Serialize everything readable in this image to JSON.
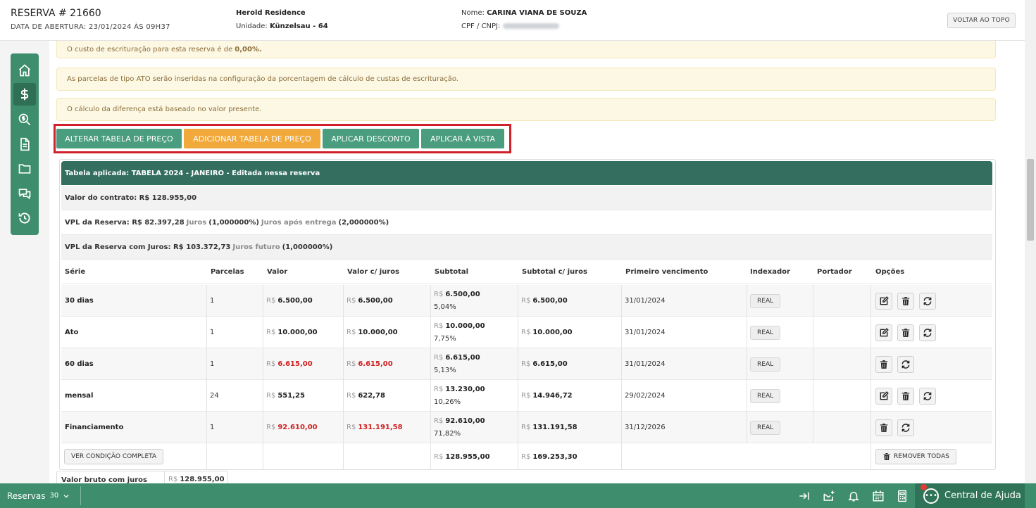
{
  "header": {
    "title": "RESERVA # 21660",
    "opening_label": "DATA DE ABERTURA:",
    "opening_value": "23/01/2024 ÀS 09H37",
    "empreendimento": "Herold Residence",
    "unidade_label": "Unidade:",
    "unidade_value": "Künzelsau - 64",
    "nome_label": "Nome:",
    "nome_value": "CARINA VIANA DE SOUZA",
    "cpf_label": "CPF / CNPJ:",
    "back_to_top": "VOLTAR AO TOPO"
  },
  "sidebar": {
    "items": [
      {
        "icon": "home-icon"
      },
      {
        "icon": "dollar-icon",
        "active": true
      },
      {
        "icon": "search-dollar-icon"
      },
      {
        "icon": "document-icon"
      },
      {
        "icon": "folder-icon"
      },
      {
        "icon": "comments-icon"
      },
      {
        "icon": "history-icon"
      }
    ]
  },
  "alerts": [
    {
      "text": "O custo de escrituração para esta reserva é de ",
      "strong": "0,00%."
    },
    {
      "text": "As parcelas de tipo ATO serão inseridas na configuração da porcentagem de cálculo de custas de escrituração."
    },
    {
      "text": "O cálculo da diferença está baseado no valor presente."
    }
  ],
  "actions": {
    "alterar": "ALTERAR TABELA DE PREÇO",
    "adicionar": "ADICIONAR TABELA DE PREÇO",
    "desconto": "APLICAR DESCONTO",
    "avista": "APLICAR À VISTA"
  },
  "table": {
    "applied": "Tabela aplicada: TABELA 2024 - JANEIRO - Editada nessa reserva",
    "contrato": "Valor do contrato: R$ 128.955,00",
    "vpl_label": "VPL da Reserva: R$ 82.397,28",
    "vpl_juros_lbl": "Juros",
    "vpl_juros_val": "(1,000000%)",
    "vpl_apos_lbl": "Juros após entrega",
    "vpl_apos_val": "(2,000000%)",
    "vplj_label": "VPL da Reserva com Juros: R$ 103.372,73",
    "vplj_fut_lbl": "Juros futuro",
    "vplj_fut_val": "(1,000000%)",
    "columns": [
      "Série",
      "Parcelas",
      "Valor",
      "Valor c/ juros",
      "Subtotal",
      "Subtotal c/ juros",
      "Primeiro vencimento",
      "Indexador",
      "Portador",
      "Opções"
    ],
    "currency": "R$",
    "rows": [
      {
        "serie": "30 dias",
        "parcelas": "1",
        "valor": "6.500,00",
        "valor_juros": "6.500,00",
        "subtotal": "6.500,00",
        "pct": "5,04%",
        "subtotal_juros": "6.500,00",
        "vencimento": "31/01/2024",
        "indexador": "REAL",
        "edit": true
      },
      {
        "serie": "Ato",
        "parcelas": "1",
        "valor": "10.000,00",
        "valor_juros": "10.000,00",
        "subtotal": "10.000,00",
        "pct": "7,75%",
        "subtotal_juros": "10.000,00",
        "vencimento": "31/01/2024",
        "indexador": "REAL",
        "edit": true
      },
      {
        "serie": "60 dias",
        "parcelas": "1",
        "valor": "6.615,00",
        "valor_juros": "6.615,00",
        "subtotal": "6.615,00",
        "pct": "5,13%",
        "subtotal_juros": "6.615,00",
        "vencimento": "31/01/2024",
        "indexador": "REAL",
        "edit": false,
        "red": true
      },
      {
        "serie": "mensal",
        "parcelas": "24",
        "valor": "551,25",
        "valor_juros": "622,78",
        "subtotal": "13.230,00",
        "pct": "10,26%",
        "subtotal_juros": "14.946,72",
        "vencimento": "29/02/2024",
        "indexador": "REAL",
        "edit": true
      },
      {
        "serie": "Financiamento",
        "parcelas": "1",
        "valor": "92.610,00",
        "valor_juros": "131.191,58",
        "subtotal": "92.610,00",
        "pct": "71,82%",
        "subtotal_juros": "131.191,58",
        "vencimento": "31/12/2026",
        "indexador": "REAL",
        "edit": false,
        "red": true
      }
    ],
    "footer": {
      "ver_condicao": "VER CONDIÇÃO COMPLETA",
      "subtotal": "128.955,00",
      "subtotal_juros": "169.253,30",
      "remover": "REMOVER TODAS"
    }
  },
  "bruto": {
    "label": "Valor bruto com juros",
    "value": "128.955,00"
  },
  "bottombar": {
    "reservas": "Reservas",
    "count": "30",
    "help": "Central de Ajuda",
    "colors": {
      "bar": "#3e8e6e",
      "help": "#2f7358"
    }
  }
}
